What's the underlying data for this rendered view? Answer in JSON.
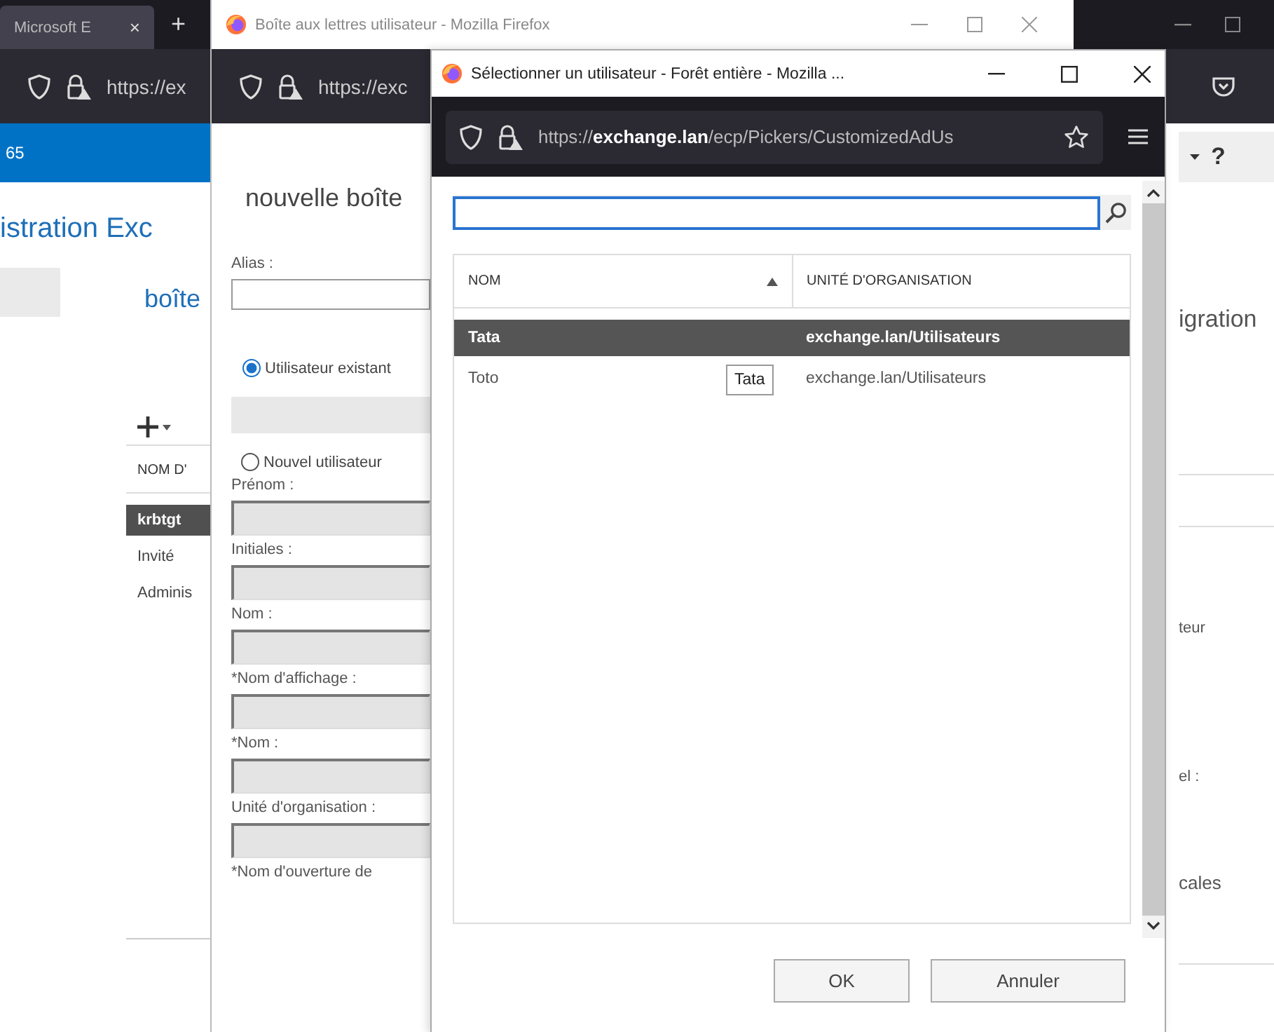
{
  "background_window": {
    "tab": {
      "label": "Microsoft E",
      "close": "×"
    },
    "new_tab": "+",
    "address": "https://ex",
    "app_bar": {
      "title": "65",
      "help": "?"
    },
    "page_title": "istration Exc",
    "section_title": "boîte",
    "list_header": "NOM D'",
    "rows": [
      {
        "name": "krbtgt",
        "selected": true
      },
      {
        "name": "Invité",
        "selected": false
      },
      {
        "name": "Adminis",
        "selected": false
      }
    ],
    "right_labels": [
      "igration",
      "teur",
      "el :",
      "cales"
    ]
  },
  "dialog_window": {
    "title": "Boîte aux lettres utilisateur - Mozilla Firefox",
    "address": "https://exc",
    "heading": "nouvelle boîte",
    "alias_label": "Alias :",
    "user_options": [
      {
        "label": "Utilisateur existant",
        "selected": true,
        "field_disabled": true
      },
      {
        "label": "Nouvel utilisateur",
        "selected": false
      }
    ],
    "fields": [
      {
        "label": "Prénom :",
        "disabled": true
      },
      {
        "label": "Initiales :",
        "disabled": true
      },
      {
        "label": "Nom :",
        "disabled": true
      },
      {
        "label": "*Nom d'affichage :",
        "disabled": true
      },
      {
        "label": "*Nom :",
        "disabled": true
      },
      {
        "label": "Unité d'organisation :",
        "disabled": true
      }
    ],
    "last_label": "*Nom d'ouverture de"
  },
  "picker_window": {
    "title": "Sélectionner un utilisateur - Forêt entière - Mozilla ...",
    "address": "https://**exchange.lan**/ecp/Pickers/CustomizedAdUs",
    "search": {
      "focused": true
    },
    "columns": [
      {
        "label": "NOM",
        "sorted": true
      },
      {
        "label": "UNITÉ D'ORGANISATION",
        "sorted": false
      }
    ],
    "rows": [
      {
        "name": "Tata",
        "unit": "exchange.lan/Utilisateurs",
        "selected": true
      },
      {
        "name": "Toto",
        "unit": "exchange.lan/Utilisateurs",
        "selected": false
      }
    ],
    "tooltip": "Tata",
    "buttons": [
      "OK",
      "Annuler"
    ]
  }
}
